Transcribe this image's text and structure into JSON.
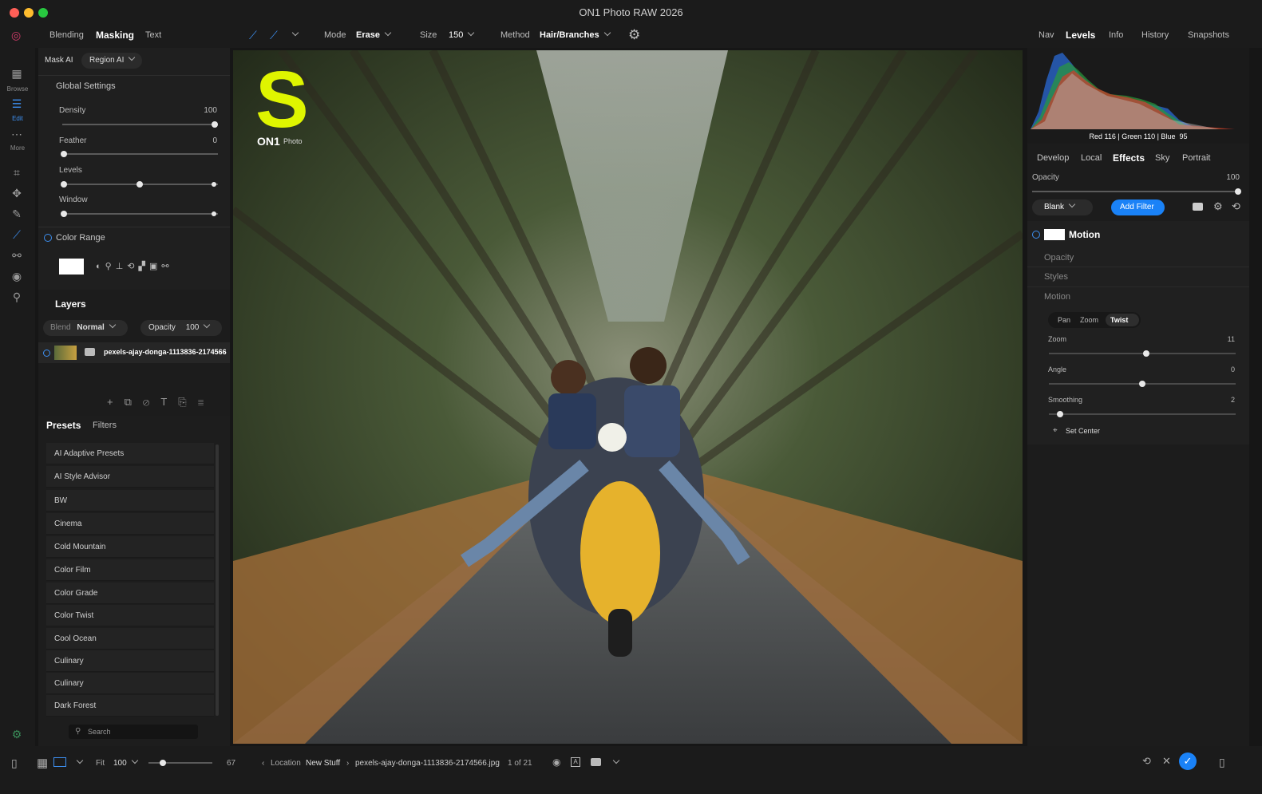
{
  "window": {
    "title": "ON1 Photo RAW 2026"
  },
  "left_tabs": [
    "Blending",
    "Masking",
    "Text"
  ],
  "toolbar": {
    "mode_label": "Mode",
    "mode_value": "Erase",
    "size_label": "Size",
    "size_value": "150",
    "method_label": "Method",
    "method_value": "Hair/Branches"
  },
  "right_tabs": [
    "Nav",
    "Levels",
    "Info",
    "History",
    "Snapshots"
  ],
  "sidebar": {
    "browse": "Browse",
    "edit": "Edit",
    "more": "More"
  },
  "mask": {
    "mask_ai": "Mask AI",
    "region_ai": "Region AI",
    "global_settings": "Global Settings",
    "density_label": "Density",
    "density_value": "100",
    "density_fraction": 1.0,
    "feather_label": "Feather",
    "feather_value": "0",
    "feather_fraction": 0.0,
    "levels_label": "Levels",
    "window_label": "Window",
    "color_range": "Color Range"
  },
  "layers": {
    "title": "Layers",
    "blend_label": "Blend",
    "blend_value": "Normal",
    "opacity_label": "Opacity",
    "opacity_value": "100",
    "layer_name": "pexels-ajay-donga-1113836-2174566"
  },
  "presets": {
    "tab_presets": "Presets",
    "tab_filters": "Filters",
    "items": [
      "AI Adaptive Presets",
      "AI Style Advisor",
      "BW",
      "Cinema",
      "Cold Mountain",
      "Color Film",
      "Color Grade",
      "Color Twist",
      "Cool Ocean",
      "Culinary",
      "Culinary",
      "Dark Forest"
    ],
    "search_placeholder": "Search"
  },
  "histogram": {
    "readout": "Red 116 | Green 110 | Blue  95"
  },
  "module_tabs": [
    "Develop",
    "Local",
    "Effects",
    "Sky",
    "Portrait"
  ],
  "effects": {
    "opacity_label": "Opacity",
    "opacity_value": "100",
    "opacity_fraction": 1.0,
    "blank": "Blank",
    "add_filter": "Add Filter",
    "filter_name": "Motion",
    "sub_opacity": "Opacity",
    "sub_styles": "Styles",
    "sub_motion": "Motion",
    "motion_modes": [
      "Pan",
      "Zoom",
      "Twist"
    ],
    "zoom_label": "Zoom",
    "zoom_value": "11",
    "angle_label": "Angle",
    "angle_value": "0",
    "smoothing_label": "Smoothing",
    "smoothing_value": "2",
    "set_center": "Set Center"
  },
  "canvas": {
    "logo_letter": "S",
    "logo_text": "ON1",
    "logo_sub": "Photo"
  },
  "bottombar": {
    "fit_label": "Fit",
    "fit_value": "100",
    "thumb_size": "67",
    "location_label": "Location",
    "location_value": "New Stuff",
    "file_name": "pexels-ajay-donga-1113836-2174566.jpg",
    "count": "1 of 21"
  },
  "colors": {
    "accent": "#1a82f7",
    "logo": "#dff500"
  }
}
